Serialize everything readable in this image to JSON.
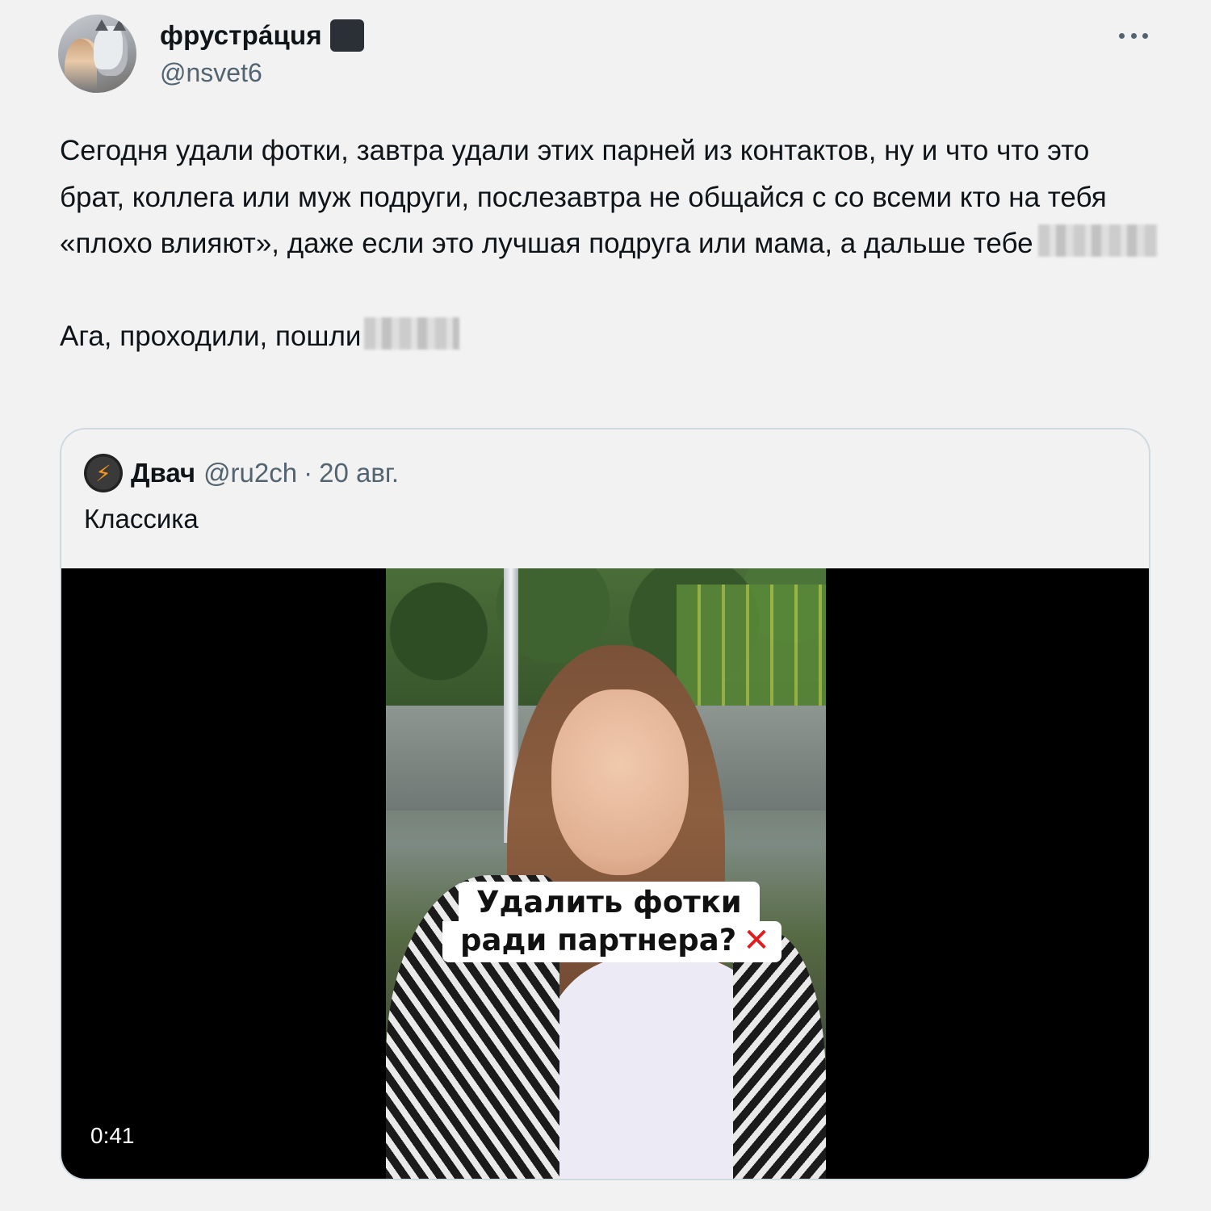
{
  "author": {
    "display_name": "фрустрáцuя",
    "handle": "@nsvet6"
  },
  "tweet": {
    "paragraph1": "Сегодня удали фотки, завтра удали этих парней из контактов, ну и что что это брат, коллега или муж подруги, послезавтра не общайся с со всеми кто на тебя «плохо влияют», даже если это лучшая подруга или мама, а дальше тебе",
    "paragraph2": "Ага, проходили, пошли"
  },
  "quoted_tweet": {
    "display_name": "Двач",
    "handle": "@ru2ch",
    "separator": "·",
    "date": "20 авг.",
    "text": "Классика",
    "avatar_glyph": "⚡",
    "video": {
      "caption_line1": "Удалить фотки",
      "caption_line2": "ради партнера?",
      "caption_mark": "✕",
      "duration": "0:41"
    }
  },
  "icons": {
    "more": "more-horizontal-icon",
    "censored": "blurred-censor-icon"
  },
  "colors": {
    "background": "#f2f2f2",
    "text": "#0f1419",
    "secondary": "#536471",
    "border": "#cfd9de",
    "cross": "#e21c1c"
  }
}
